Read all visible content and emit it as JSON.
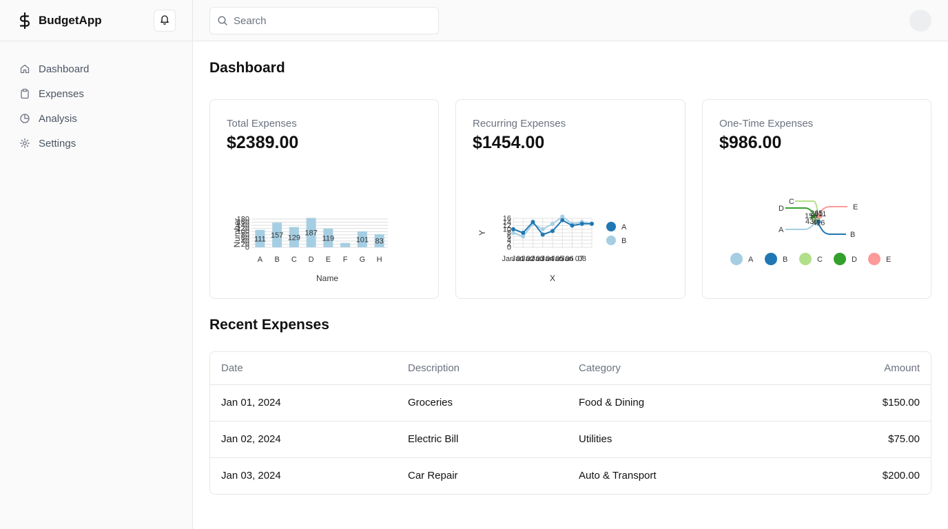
{
  "app": {
    "name": "BudgetApp"
  },
  "sidebar": {
    "items": [
      {
        "label": "Dashboard",
        "icon": "home-icon"
      },
      {
        "label": "Expenses",
        "icon": "clipboard-icon"
      },
      {
        "label": "Analysis",
        "icon": "pie-chart-icon"
      },
      {
        "label": "Settings",
        "icon": "gear-icon"
      }
    ]
  },
  "search": {
    "placeholder": "Search"
  },
  "page": {
    "title": "Dashboard"
  },
  "cards": [
    {
      "label": "Total Expenses",
      "value": "$2389.00"
    },
    {
      "label": "Recurring Expenses",
      "value": "$1454.00"
    },
    {
      "label": "One-Time Expenses",
      "value": "$986.00"
    }
  ],
  "chart_data": [
    {
      "type": "bar",
      "categories": [
        "A",
        "B",
        "C",
        "D",
        "E",
        "F",
        "G",
        "H"
      ],
      "values": [
        111,
        157,
        129,
        187,
        119,
        28,
        101,
        83
      ],
      "data_labels": [
        "111",
        "157",
        "129",
        "187",
        "119",
        "",
        "101",
        "83"
      ],
      "xlabel": "Name",
      "ylabel": "Number",
      "ylim": [
        0,
        180
      ],
      "yticks": [
        "0",
        "20",
        "40",
        "60",
        "80",
        "100",
        "120",
        "140",
        "160",
        "180"
      ],
      "grid": true,
      "color": "#a6cee3"
    },
    {
      "type": "line",
      "x": [
        "Jan",
        "01",
        "02",
        "03",
        "04",
        "05",
        "06",
        "07",
        "08"
      ],
      "xticks_display": [
        "Jan 01",
        "Jan 02",
        "Jan 03",
        "Jan 04",
        "Jan 05",
        "Jan 06",
        "Jan 07",
        "08"
      ],
      "series": [
        {
          "name": "A",
          "values": [
            10,
            8,
            14,
            7,
            9,
            15,
            12,
            13,
            13
          ],
          "color": "#1f78b4"
        },
        {
          "name": "B",
          "values": [
            8,
            6,
            13,
            10,
            13,
            17,
            13,
            14,
            13
          ],
          "color": "#a6cee3"
        }
      ],
      "xlabel": "X",
      "ylabel": "Y",
      "ylim": [
        0,
        16
      ],
      "yticks": [
        "0",
        "2",
        "4",
        "6",
        "8",
        "10",
        "12",
        "14",
        "16"
      ],
      "grid": true,
      "legend": "right"
    },
    {
      "type": "other",
      "subtype": "bump",
      "series": [
        {
          "name": "A",
          "color": "#a6cee3"
        },
        {
          "name": "B",
          "color": "#1f78b4"
        },
        {
          "name": "C",
          "color": "#b2df8a"
        },
        {
          "name": "D",
          "color": "#33a02c"
        },
        {
          "name": "E",
          "color": "#fb9a99"
        }
      ],
      "data_labels": [
        "150",
        "265",
        "311",
        "436",
        "416"
      ],
      "legend": "bottom"
    }
  ],
  "recent": {
    "title": "Recent Expenses",
    "headers": {
      "date": "Date",
      "description": "Description",
      "category": "Category",
      "amount": "Amount"
    },
    "rows": [
      {
        "date": "Jan 01, 2024",
        "description": "Groceries",
        "category": "Food & Dining",
        "amount": "$150.00"
      },
      {
        "date": "Jan 02, 2024",
        "description": "Electric Bill",
        "category": "Utilities",
        "amount": "$75.00"
      },
      {
        "date": "Jan 03, 2024",
        "description": "Car Repair",
        "category": "Auto & Transport",
        "amount": "$200.00"
      }
    ]
  }
}
